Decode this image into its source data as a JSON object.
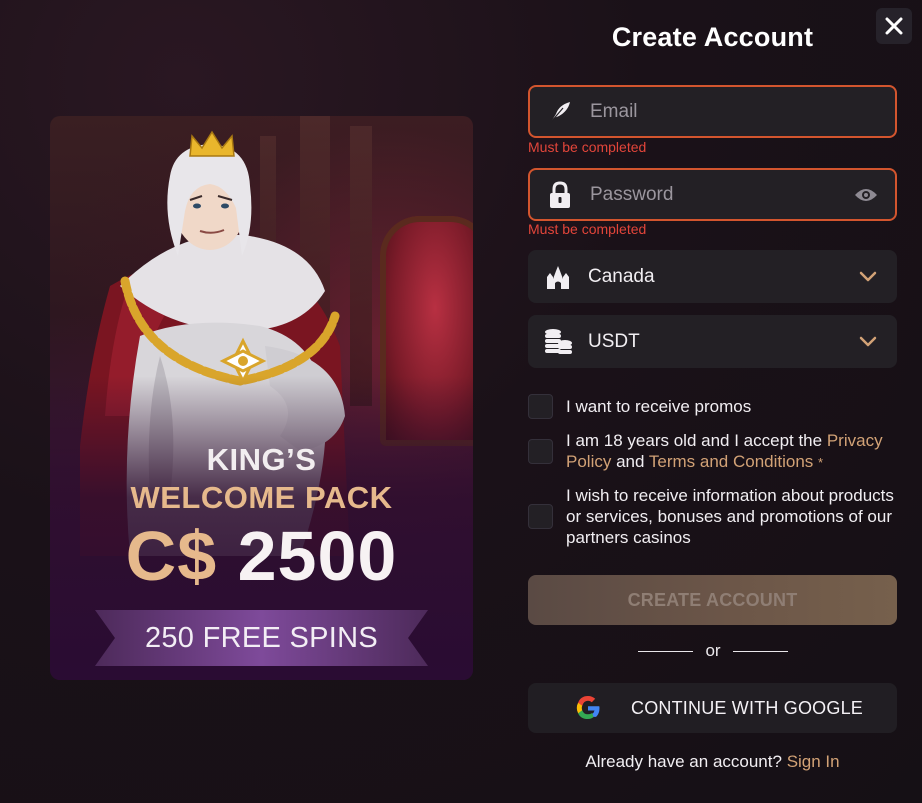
{
  "title": "Create Account",
  "close_label": "✕",
  "promo": {
    "line1": "KING’S",
    "line2": "WELCOME PACK",
    "currency": "C$",
    "amount": "2500",
    "spins": "250 FREE SPINS"
  },
  "form": {
    "email": {
      "placeholder": "Email",
      "error": "Must be completed"
    },
    "password": {
      "placeholder": "Password",
      "error": "Must be completed"
    },
    "country": {
      "value": "Canada"
    },
    "currency": {
      "value": "USDT"
    }
  },
  "checks": {
    "promos": "I want to receive promos",
    "age_prefix": "I am 18 years old and I accept the",
    "privacy": "Privacy Policy",
    "and": "and",
    "terms": "Terms and Conditions",
    "asterisk": "*",
    "partners": "I wish to receive information about products or services, bonuses and promotions of our partners casinos"
  },
  "create_button": "CREATE ACCOUNT",
  "or": "or",
  "google_button": "CONTINUE WITH GOOGLE",
  "signin": {
    "prompt": "Already have an account?",
    "link": "Sign In"
  },
  "colors": {
    "accent": "#d2a276",
    "error": "#e2453a",
    "error_border": "#d3552e",
    "field_bg": "#232025"
  }
}
